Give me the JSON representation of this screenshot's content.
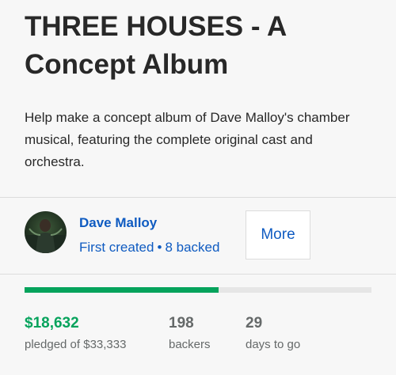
{
  "project": {
    "title": "THREE HOUSES - A Concept Album",
    "blurb": "Help make a concept album of Dave Malloy's chamber musical, featuring the complete original cast and orchestra."
  },
  "creator": {
    "name": "Dave Malloy",
    "first_created": "First created",
    "separator": "•",
    "backed": "8 backed",
    "more_label": "More"
  },
  "funding": {
    "progress_fraction": 0.559,
    "progress_color": "#05a35c",
    "pledged_amount": "$18,632",
    "pledged_label": "pledged of $33,333",
    "backers_count": "198",
    "backers_label": "backers",
    "days_count": "29",
    "days_label": "days to go"
  },
  "colors": {
    "link": "#0f5bc1",
    "accent_green": "#05a35c",
    "text": "#282828",
    "muted": "#656969"
  }
}
